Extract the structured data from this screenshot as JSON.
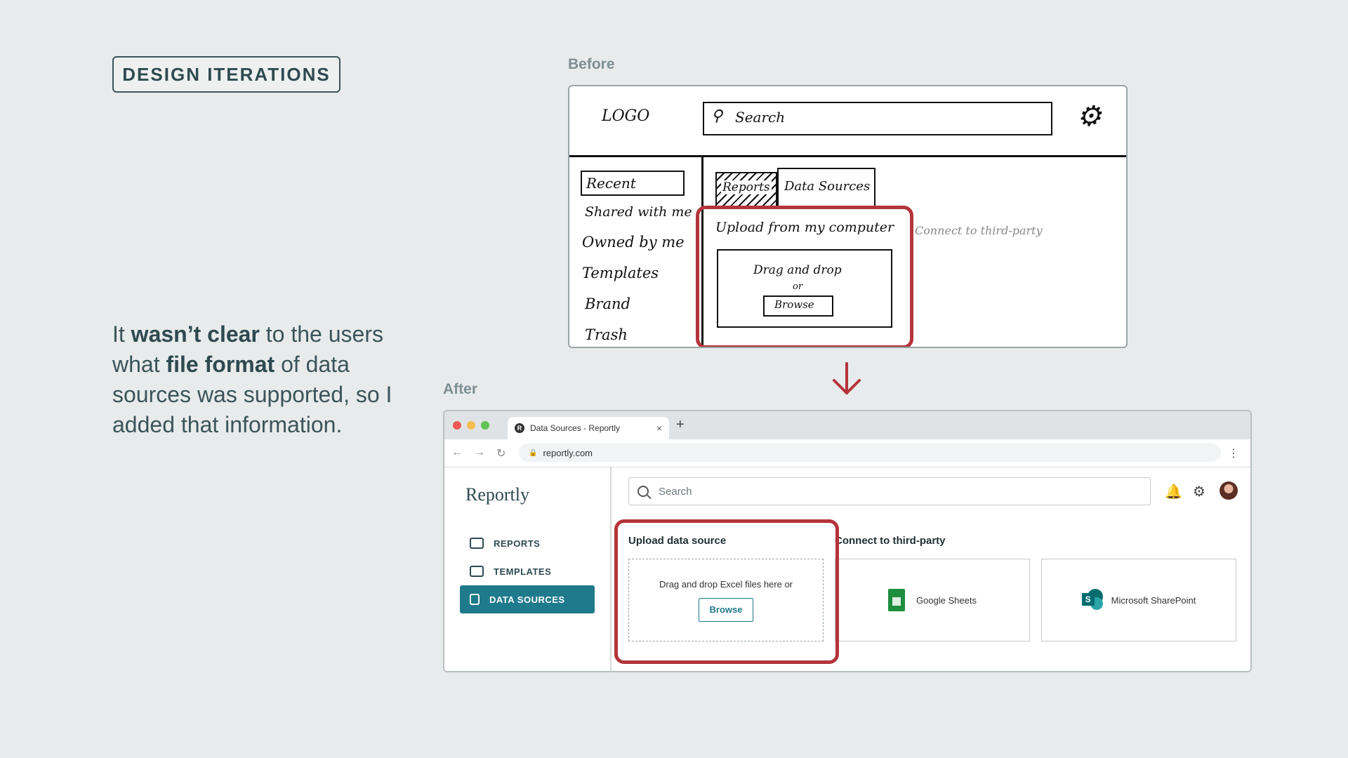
{
  "badge": "DESIGN ITERATIONS",
  "note": {
    "p1": "It ",
    "b1": "wasn’t clear",
    "p2": " to the users what ",
    "b2": "file format",
    "p3": " of data sources was supported, so I added that information."
  },
  "before": {
    "label": "Before",
    "logo": "LOGO",
    "search": "Search",
    "nav": [
      "Recent",
      "Shared with me",
      "Owned by me",
      "Templates",
      "Brand",
      "Trash"
    ],
    "tabs": [
      "Reports",
      "Data Sources"
    ],
    "upload_title": "Upload from my computer",
    "drag": "Drag and drop",
    "or": "or",
    "browse": "Browse",
    "third_party": "Connect to third-party"
  },
  "after": {
    "label": "After",
    "tab_title": "Data Sources - Reportly",
    "favicon": "R",
    "new_tab": "+",
    "url": "reportly.com",
    "brand": "Reportly",
    "nav": [
      "REPORTS",
      "TEMPLATES",
      "DATA SOURCES"
    ],
    "search_placeholder": "Search",
    "upload_title": "Upload data source",
    "drop_text": "Drag and drop Excel files here or",
    "browse": "Browse",
    "third_party_title": "Connect to third-party",
    "cards": [
      "Google Sheets",
      "Microsoft SharePoint"
    ]
  },
  "colors": {
    "accent": "#1f7a8c",
    "highlight": "#b3343a",
    "background": "#e8ebeb"
  }
}
